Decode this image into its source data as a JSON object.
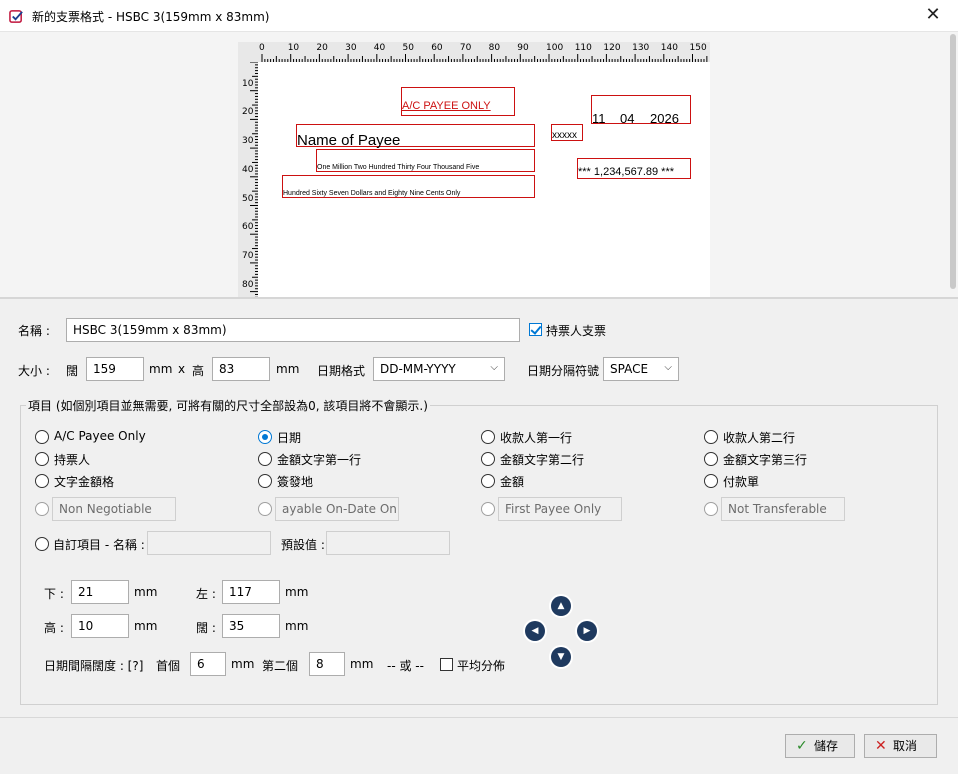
{
  "window": {
    "title": "新的支票格式 - HSBC 3(159mm x 83mm)",
    "close_glyph": "✕"
  },
  "preview": {
    "ruler_top_labels": [
      "0",
      "10",
      "20",
      "30",
      "40",
      "50",
      "60",
      "70",
      "80",
      "90",
      "100",
      "110",
      "120",
      "130",
      "140",
      "150"
    ],
    "ruler_left_labels": [
      "10",
      "20",
      "30",
      "40",
      "50",
      "60",
      "70",
      "80"
    ],
    "fields": {
      "ac_payee": "A/C PAYEE ONLY",
      "date_day": "11",
      "date_month": "04",
      "date_year": "2026",
      "payee": "Name of Payee",
      "xxxxx": "xxxxx",
      "amount_words_1": "One Million Two Hundred Thirty Four Thousand Five",
      "amount_figure": "*** 1,234,567.89 ***",
      "amount_words_2": "Hundred Sixty Seven Dollars and Eighty Nine Cents Only"
    },
    "accent_color": "#cc1111"
  },
  "form": {
    "name_label": "名稱 :",
    "name_value": "HSBC 3(159mm x 83mm)",
    "bearer_label": "持票人支票",
    "bearer_checked": true,
    "size_label": "大小 :",
    "width_label": "闊",
    "width_value": "159",
    "mm": "mm",
    "x": "x",
    "height_label": "高",
    "height_value": "83",
    "date_format_label": "日期格式",
    "date_format_value": "DD-MM-YYYY",
    "date_sep_label": "日期分隔符號",
    "date_sep_value": "SPACE",
    "items_title": "項目 (如個別項目並無需要, 可將有關的尺寸全部設為0, 該項目將不會顯示.)",
    "items": [
      {
        "label": "A/C Payee Only",
        "selected": false
      },
      {
        "label": "日期",
        "selected": true
      },
      {
        "label": "收款人第一行",
        "selected": false
      },
      {
        "label": "收款人第二行",
        "selected": false
      },
      {
        "label": "持票人",
        "selected": false
      },
      {
        "label": "金額文字第一行",
        "selected": false
      },
      {
        "label": "金額文字第二行",
        "selected": false
      },
      {
        "label": "金額文字第三行",
        "selected": false
      },
      {
        "label": "文字金額格",
        "selected": false
      },
      {
        "label": "簽發地",
        "selected": false
      },
      {
        "label": "金額",
        "selected": false
      },
      {
        "label": "付款單",
        "selected": false
      }
    ],
    "text_items": [
      "Non Negotiable",
      "ayable On-Date Only",
      "First Payee Only",
      "Not Transferable"
    ],
    "custom_label": "自訂項目 - 名稱 :",
    "custom_name": "",
    "default_label": "預設值 :",
    "default_value": "",
    "bottom_label": "下 :",
    "bottom_value": "21",
    "left_label": "左 :",
    "left_value": "117",
    "h_label": "高 :",
    "h_value": "10",
    "w_label": "闊 :",
    "w_value": "35",
    "date_spacing_label": "日期間隔闊度 : [?]",
    "first_label": "首個",
    "first_value": "6",
    "second_label": "第二個",
    "second_value": "8",
    "or_label": "-- 或 --",
    "even_label": "平均分佈",
    "even_checked": false
  },
  "footer": {
    "save_label": "儲存",
    "cancel_label": "取消"
  }
}
